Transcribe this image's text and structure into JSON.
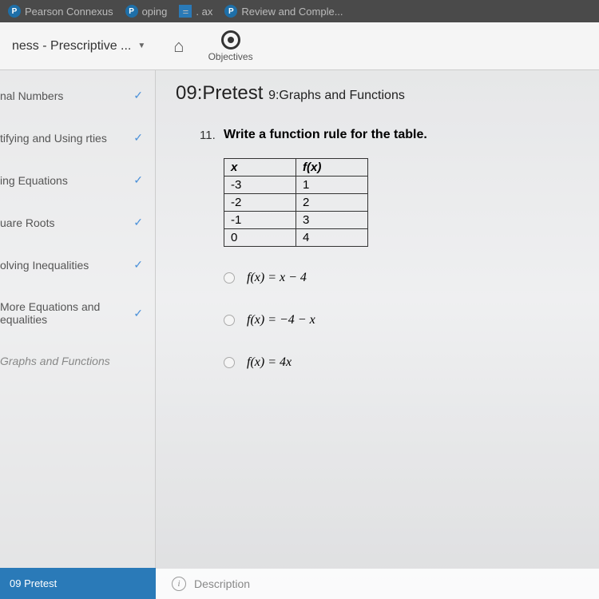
{
  "tabs": [
    {
      "label": "Pearson Connexus",
      "icon": "P"
    },
    {
      "label": "oping",
      "icon": "P"
    },
    {
      "label": ". ax",
      "icon": "="
    },
    {
      "label": "Review and Comple...",
      "icon": "P"
    }
  ],
  "breadcrumb": {
    "title": "ness - Prescriptive ..."
  },
  "nav": {
    "objectives": "Objectives"
  },
  "sidebar": {
    "items": [
      {
        "label": "nal Numbers",
        "done": true
      },
      {
        "label": "tifying and Using rties",
        "done": true
      },
      {
        "label": "ing Equations",
        "done": true
      },
      {
        "label": "uare Roots",
        "done": true
      },
      {
        "label": "olving Inequalities",
        "done": true
      },
      {
        "label": "More Equations and equalities",
        "done": true
      },
      {
        "label": "Graphs and Functions",
        "done": false
      }
    ],
    "bottom": "09 Pretest"
  },
  "page": {
    "title_main": "09:Pretest",
    "title_sub": "9:Graphs and Functions"
  },
  "question": {
    "number": "11.",
    "prompt": "Write a function rule for the table.",
    "table": {
      "headers": [
        "x",
        "f(x)"
      ],
      "rows": [
        [
          "-3",
          "1"
        ],
        [
          "-2",
          "2"
        ],
        [
          "-1",
          "3"
        ],
        [
          "0",
          "4"
        ]
      ]
    },
    "options": [
      "f(x) = x − 4",
      "f(x) = −4 − x",
      "f(x) = 4x"
    ]
  },
  "footer": {
    "desc": "Description"
  }
}
